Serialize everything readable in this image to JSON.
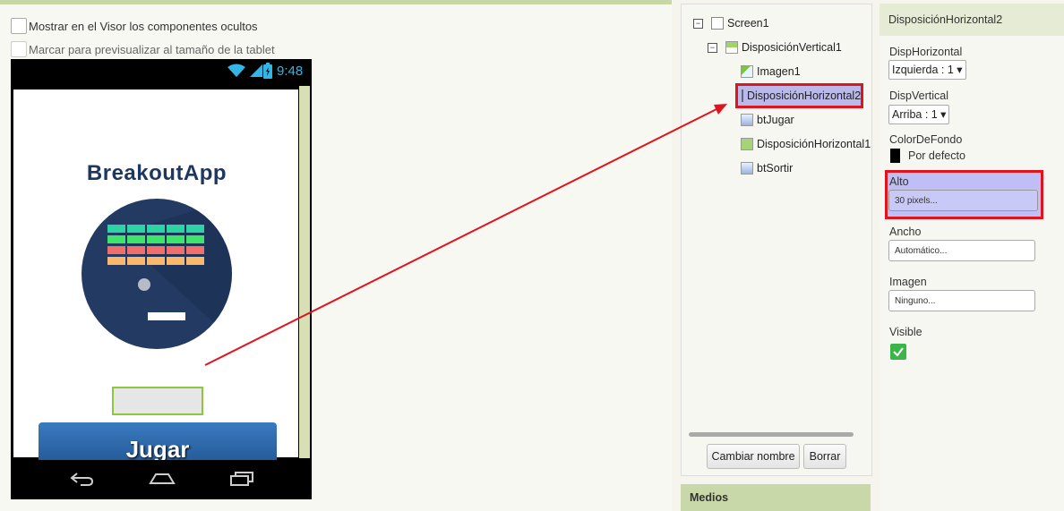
{
  "viewer": {
    "show_hidden_label": "Mostrar en el Visor los componentes ocultos",
    "tablet_preview_label": "Marcar para previsualizar al tamaño de la tablet",
    "status_time": "9:48",
    "app_title": "BreakoutApp",
    "jugar_label": "Jugar"
  },
  "components": {
    "items": [
      {
        "label": "Screen1"
      },
      {
        "label": "DisposiciónVertical1"
      },
      {
        "label": "Imagen1"
      },
      {
        "label": "DisposiciónHorizontal2"
      },
      {
        "label": "btJugar"
      },
      {
        "label": "DisposiciónHorizontal1"
      },
      {
        "label": "btSortir"
      }
    ],
    "rename_label": "Cambiar nombre",
    "delete_label": "Borrar",
    "media_label": "Medios"
  },
  "properties": {
    "header": "DisposiciónHorizontal2",
    "disp_horizontal_label": "DispHorizontal",
    "disp_horizontal_value": "Izquierda : 1 ▾",
    "disp_vertical_label": "DispVertical",
    "disp_vertical_value": "Arriba : 1 ▾",
    "bg_color_label": "ColorDeFondo",
    "bg_color_value": "Por defecto",
    "alto_label": "Alto",
    "alto_value": "30 pixels...",
    "ancho_label": "Ancho",
    "ancho_value": "Automático...",
    "imagen_label": "Imagen",
    "imagen_value": "Ninguno...",
    "visible_label": "Visible"
  },
  "colors": {
    "highlight": "#e0141f",
    "selection": "#b9b9ec",
    "accent_green": "#8dc63f",
    "button_blue": "#2a64a8"
  }
}
